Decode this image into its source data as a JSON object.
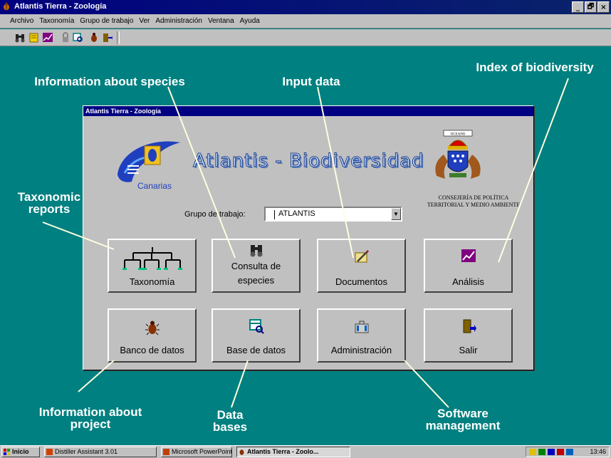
{
  "window": {
    "title": "Atlantis Tierra - Zoología",
    "controls": [
      "_",
      "🗗",
      "×"
    ]
  },
  "menu": [
    "Archivo",
    "Taxonomía",
    "Grupo de trabajo",
    "Ver",
    "Administración",
    "Ventana",
    "Ayuda"
  ],
  "toolbar_icons": [
    "binoculars-icon",
    "notebook-icon",
    "chart-icon",
    "lock-icon",
    "database-icon",
    "beetle-icon",
    "exit-icon"
  ],
  "dialog": {
    "title": "Atlantis Tierra - Zoología",
    "brand_title": "Atlantis - Biodiversidad",
    "logo_text": "Canarias",
    "coat_banner": "OCEANO",
    "consejeria": [
      "CONSEJERÍA DE POLÍTICA",
      "TERRITORIAL Y MEDIO AMBIENTE"
    ],
    "grupo_label": "Grupo de trabajo:",
    "grupo_value": "ATLANTIS",
    "buttons": {
      "taxonomia": "Taxonomía",
      "consulta_1": "Consulta de",
      "consulta_2": "especies",
      "documentos": "Documentos",
      "analisis": "Análisis",
      "banco": "Banco de datos",
      "base": "Base de datos",
      "administracion": "Administración",
      "salir": "Salir"
    }
  },
  "annotations": {
    "species": "Information about species",
    "input": "Input data",
    "biodiversity": "Index of biodiversity",
    "taxonomic_1": "Taxonomic",
    "taxonomic_2": "reports",
    "project_1": "Information about",
    "project_2": "project",
    "databases_1": "Data",
    "databases_2": "bases",
    "software_1": "Software",
    "software_2": "management"
  },
  "taskbar": {
    "start": "Inicio",
    "tasks": [
      "Distiller Assistant 3.01",
      "Microsoft PowerPoint - [Pr...",
      "Atlantis Tierra - Zoolo..."
    ],
    "clock": "13:46"
  },
  "colors": {
    "desktop": "#008080",
    "titlebar": "#000080",
    "face": "#c0c0c0",
    "annotation": "#ffffff"
  }
}
